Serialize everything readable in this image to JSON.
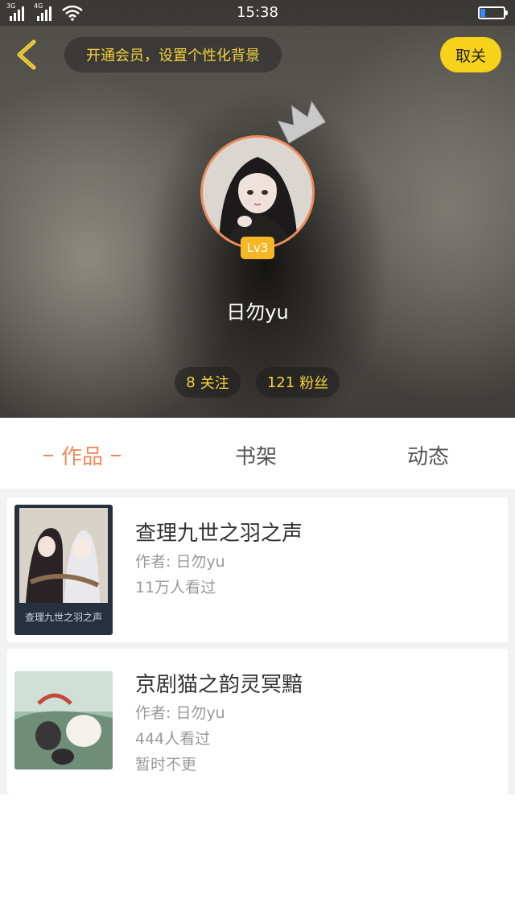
{
  "status_bar": {
    "signal_1_label": "3G",
    "signal_2_label": "4G",
    "time": "15:38"
  },
  "header": {
    "promo_text": "开通会员，设置个性化背景",
    "unfollow_label": "取关"
  },
  "profile": {
    "level": "Lv3",
    "username": "日勿yu",
    "following_count": "8",
    "following_label": "关注",
    "fans_count": "121",
    "fans_label": "粉丝"
  },
  "tabs": [
    {
      "label": "作品",
      "active": true
    },
    {
      "label": "书架",
      "active": false
    },
    {
      "label": "动态",
      "active": false
    }
  ],
  "works": [
    {
      "title": "查理九世之羽之声",
      "author": "作者: 日勿yu",
      "views": "11万人看过",
      "cover_caption": "查理九世之羽之声"
    },
    {
      "title": "京剧猫之韵灵冥黯",
      "author": "作者: 日勿yu",
      "views": "444人看过",
      "status": "暂时不更"
    }
  ],
  "colors": {
    "accent_orange": "#f08a5a",
    "accent_yellow": "#f6d23a",
    "button_yellow": "#f7d21b",
    "badge_yellow": "#f6b626"
  },
  "icons": {
    "back": "chevron-left-icon",
    "crown": "crown-icon",
    "wifi": "wifi-icon",
    "battery": "battery-icon"
  }
}
